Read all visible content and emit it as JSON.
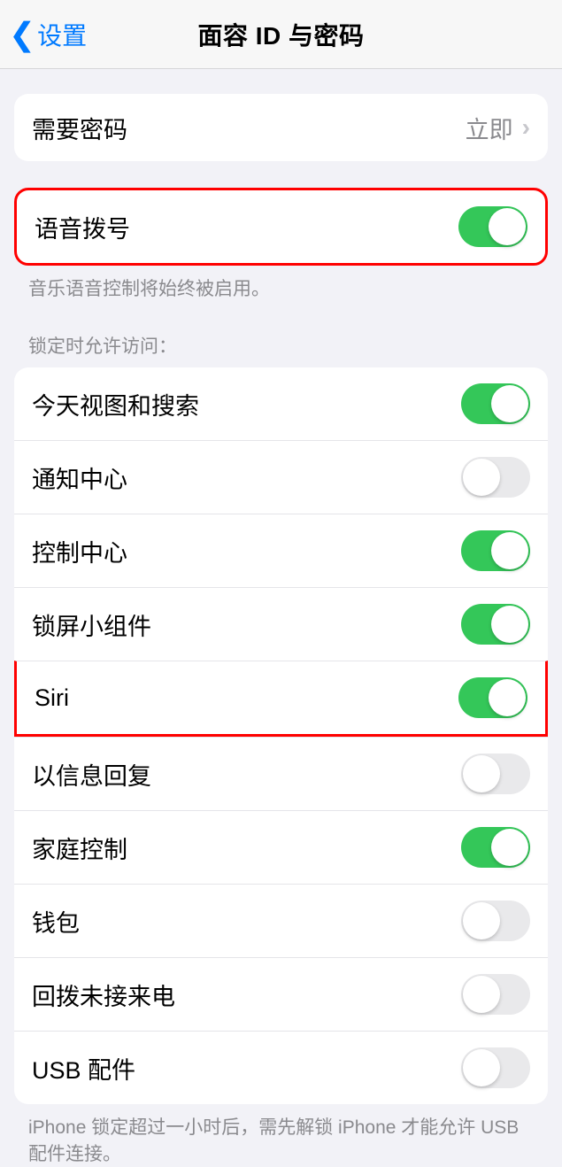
{
  "header": {
    "back_label": "设置",
    "title": "面容 ID 与密码"
  },
  "passcode": {
    "label": "需要密码",
    "value": "立即"
  },
  "voice_dial": {
    "label": "语音拨号",
    "on": true,
    "footer": "音乐语音控制将始终被启用。"
  },
  "locked_section": {
    "header": "锁定时允许访问：",
    "items": [
      {
        "label": "今天视图和搜索",
        "on": true
      },
      {
        "label": "通知中心",
        "on": false
      },
      {
        "label": "控制中心",
        "on": true
      },
      {
        "label": "锁屏小组件",
        "on": true
      },
      {
        "label": "Siri",
        "on": true
      },
      {
        "label": "以信息回复",
        "on": false
      },
      {
        "label": "家庭控制",
        "on": true
      },
      {
        "label": "钱包",
        "on": false
      },
      {
        "label": "回拨未接来电",
        "on": false
      },
      {
        "label": "USB 配件",
        "on": false
      }
    ],
    "footer": "iPhone 锁定超过一小时后，需先解锁 iPhone 才能允许 USB 配件连接。"
  }
}
